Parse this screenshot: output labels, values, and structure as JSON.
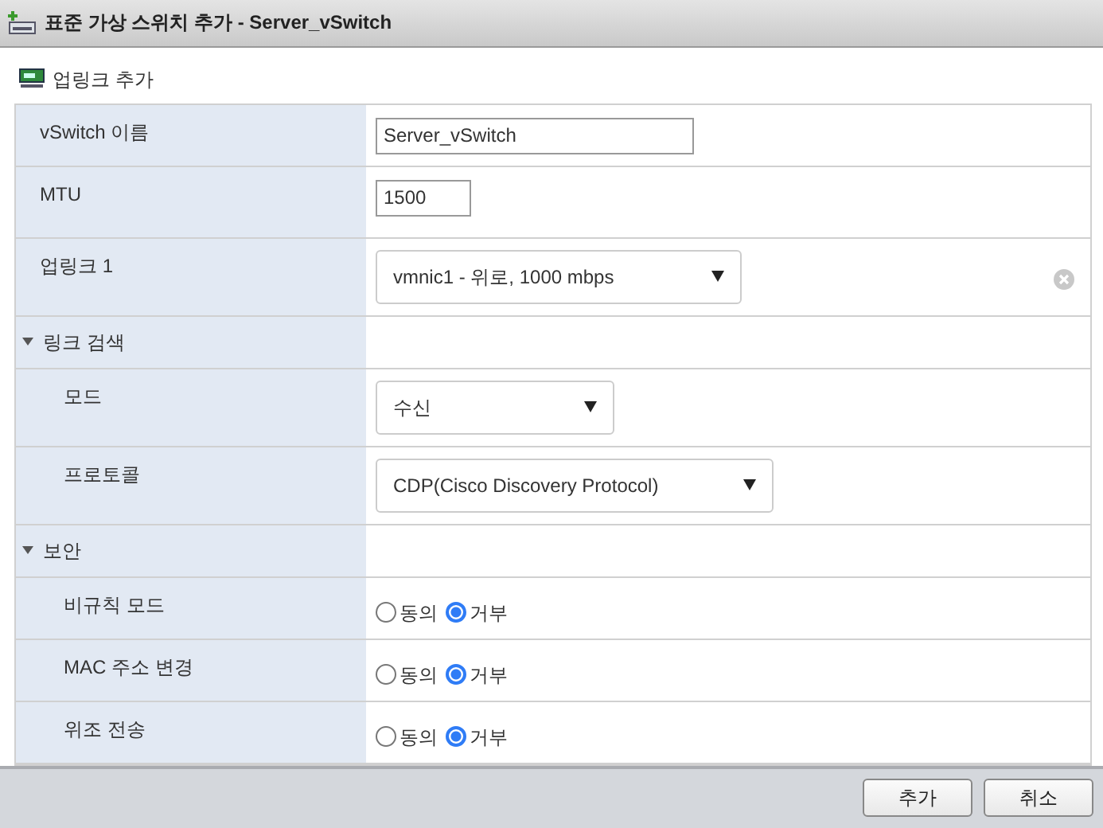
{
  "window": {
    "title": "표준 가상 스위치 추가 - Server_vSwitch"
  },
  "toolbar": {
    "action": "업링크 추가"
  },
  "rows": [
    {
      "kind": "text",
      "label": "vSwitch 이름",
      "value": "Server_vSwitch"
    },
    {
      "kind": "number",
      "label": "MTU",
      "value": "1500"
    },
    {
      "kind": "select",
      "label": "업링크 1",
      "value": "vmnic1 - 위로, 1000 mbps",
      "removable": true
    },
    {
      "kind": "section",
      "label": "링크 검색",
      "expanded": true,
      "children": [
        {
          "kind": "select",
          "label": "모드",
          "value": "수신"
        },
        {
          "kind": "select",
          "label": "프로토콜",
          "value": "CDP(Cisco Discovery Protocol)"
        }
      ]
    },
    {
      "kind": "section",
      "label": "보안",
      "expanded": true,
      "children": [
        {
          "kind": "radio",
          "label": "비규칙 모드",
          "options": [
            {
              "label": "동의",
              "selected": false
            },
            {
              "label": "거부",
              "selected": true
            }
          ]
        },
        {
          "kind": "radio",
          "label": "MAC 주소 변경",
          "options": [
            {
              "label": "동의",
              "selected": false
            },
            {
              "label": "거부",
              "selected": true
            }
          ]
        },
        {
          "kind": "radio",
          "label": "위조 전송",
          "options": [
            {
              "label": "동의",
              "selected": false
            },
            {
              "label": "거부",
              "selected": true
            }
          ]
        }
      ]
    }
  ],
  "buttons": [
    "추가",
    "취소"
  ]
}
